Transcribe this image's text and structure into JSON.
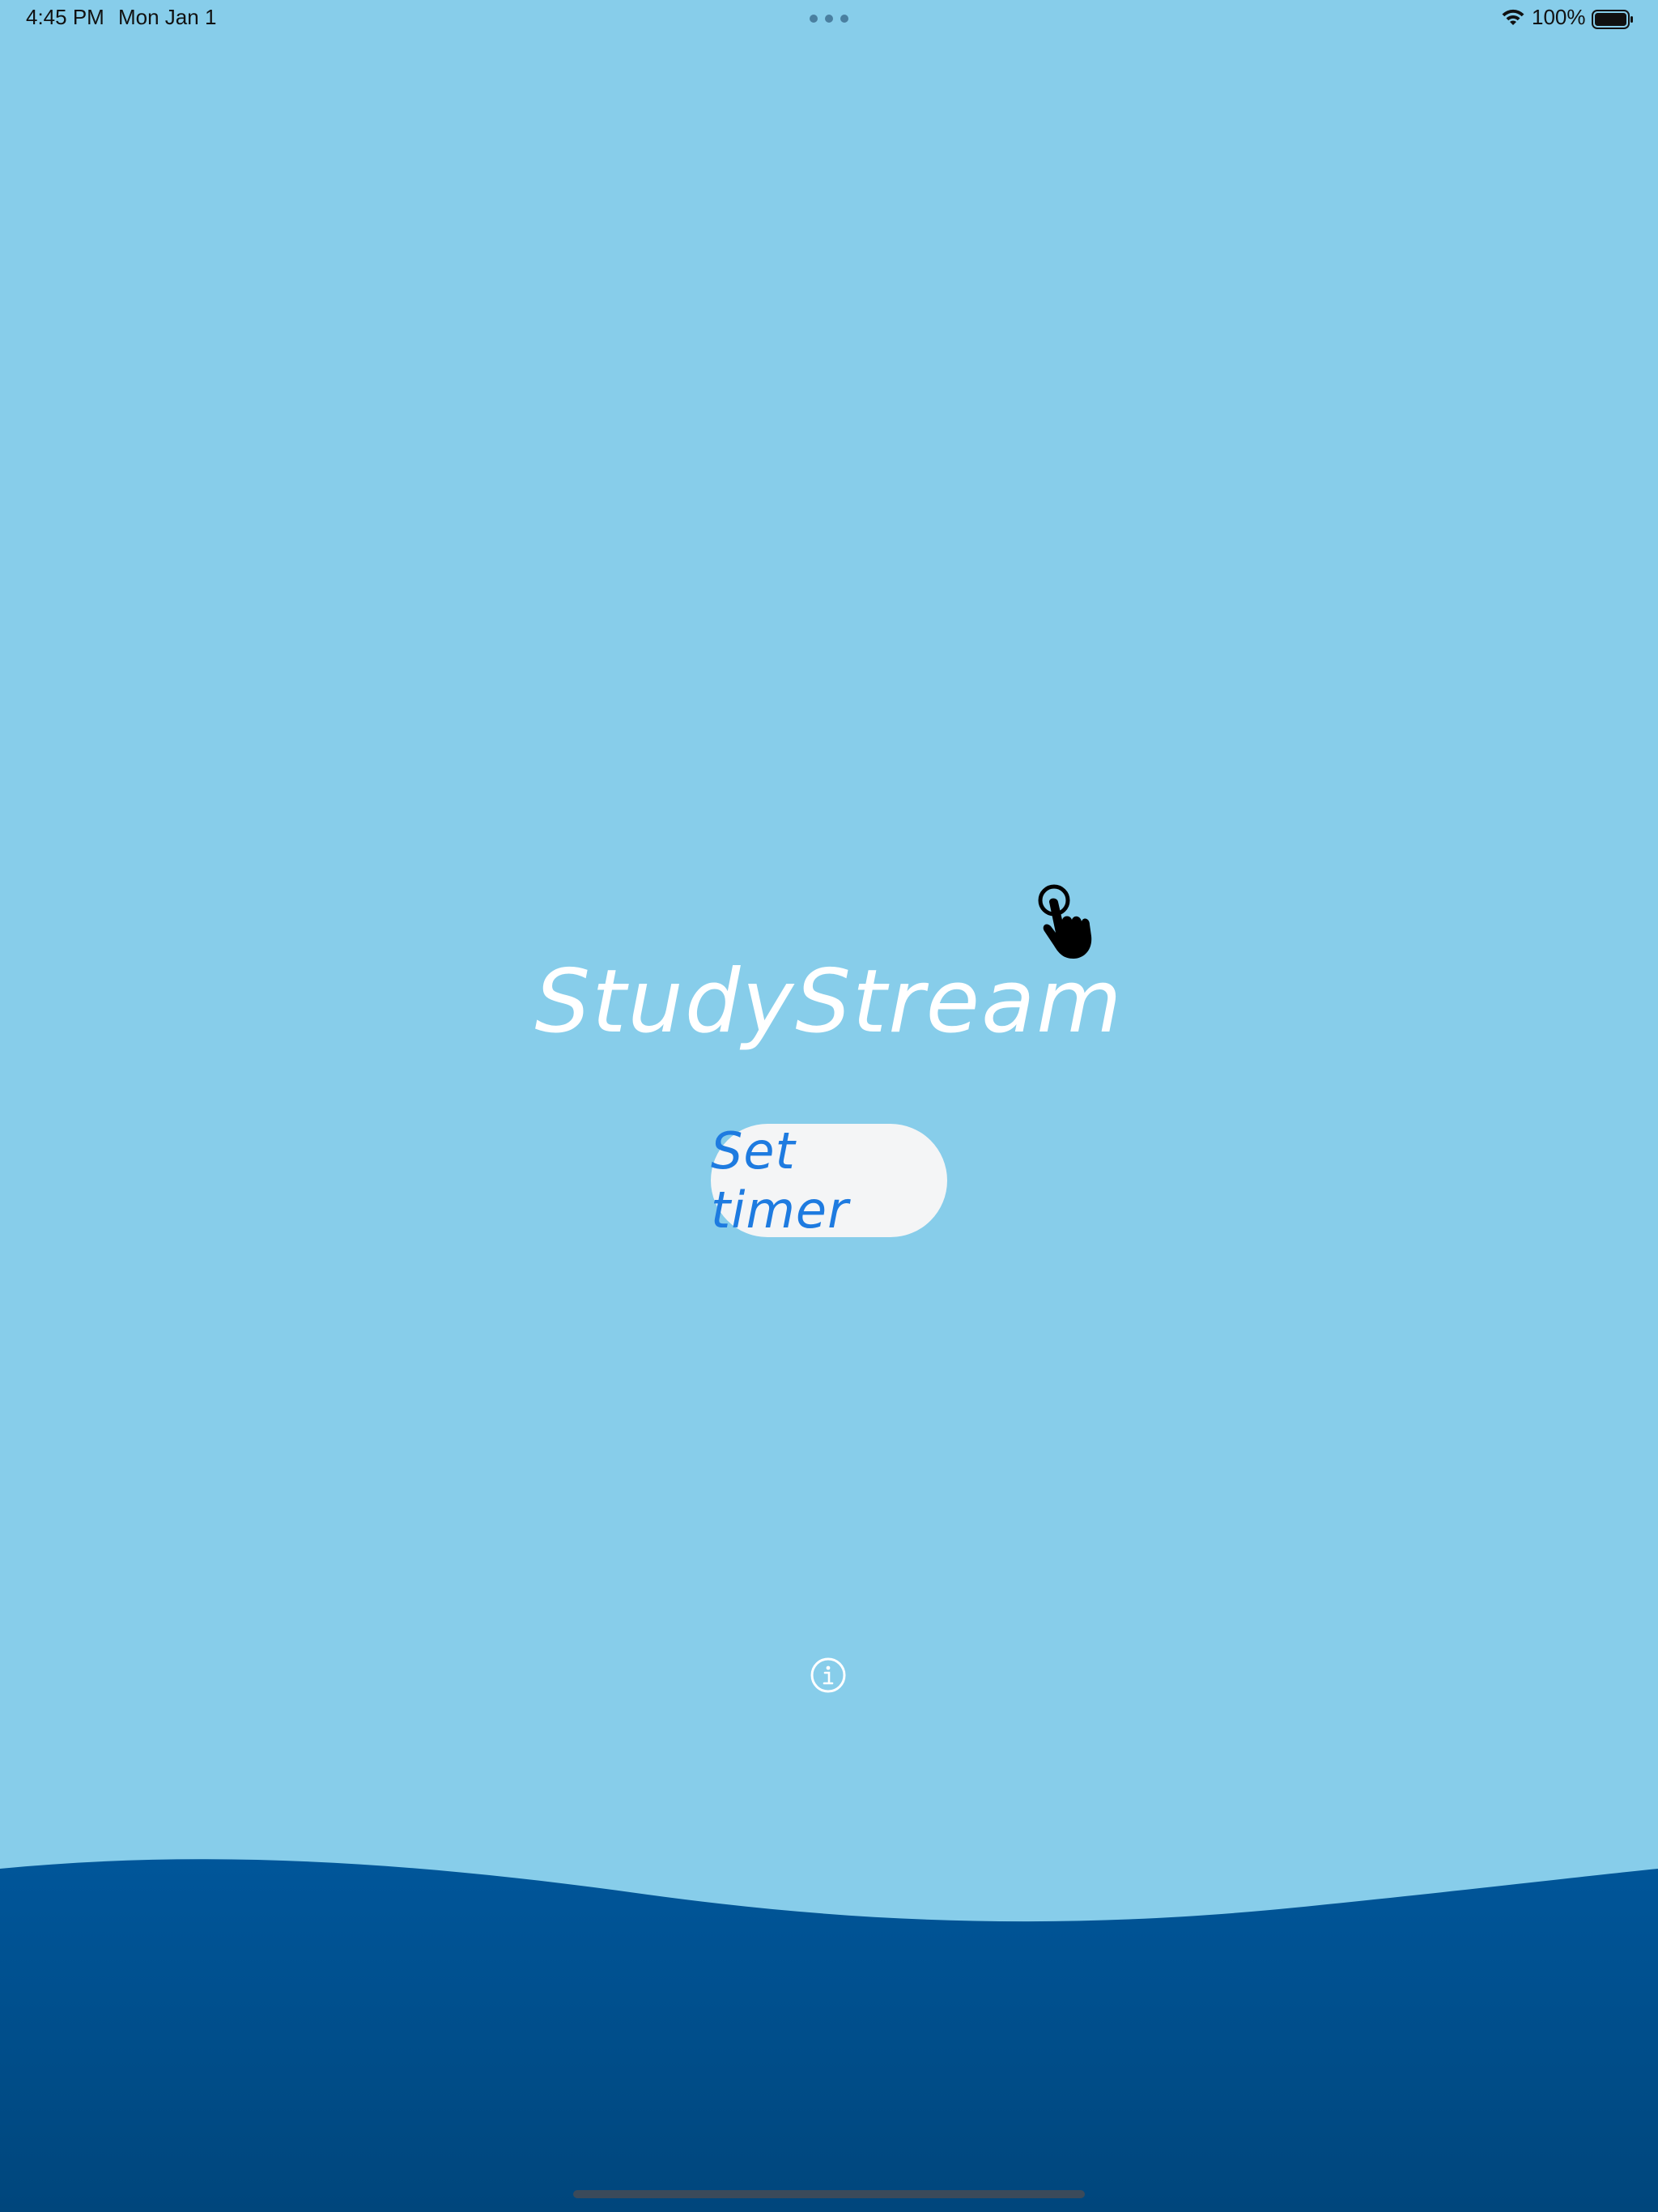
{
  "status_bar": {
    "time": "4:45 PM",
    "date": "Mon Jan 1",
    "battery_percent": "100%"
  },
  "main": {
    "title": "StudyStream",
    "set_timer_label": "Set timer"
  },
  "icons": {
    "wifi": "wifi-icon",
    "battery": "battery-icon",
    "pointer": "hand-pointer-icon",
    "info": "info-icon"
  },
  "colors": {
    "sky": "#87CDEA",
    "ocean": "#00508F",
    "button_bg": "#F4F5F6",
    "button_text": "#1E7BE0",
    "title_text": "#FFFFFF"
  }
}
